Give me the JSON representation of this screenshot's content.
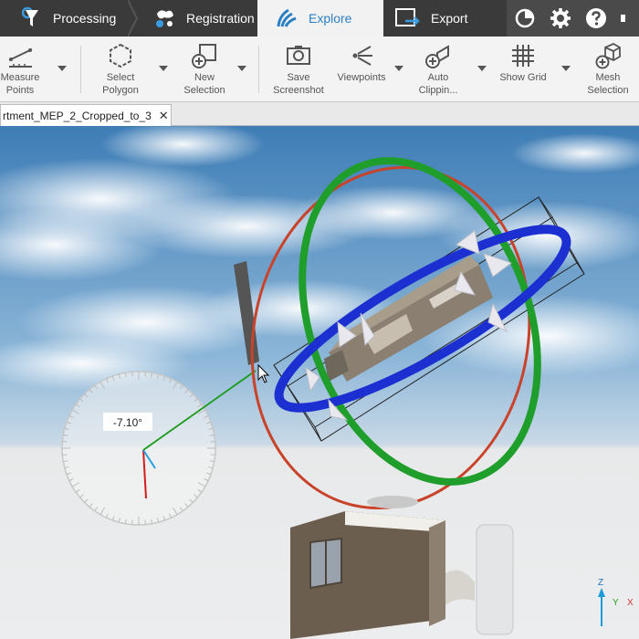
{
  "nav": {
    "tabs": [
      {
        "label": "Processing"
      },
      {
        "label": "Registration"
      },
      {
        "label": "Explore"
      },
      {
        "label": "Export"
      }
    ]
  },
  "toolbar": {
    "measure_points": "Measure\nPoints",
    "select_polygon": "Select\nPolygon",
    "new_selection": "New\nSelection",
    "save_screenshot": "Save\nScreenshot",
    "viewpoints": "Viewpoints",
    "auto_clipping": "Auto\nClippin...",
    "show_grid": "Show Grid",
    "mesh_selection": "Mesh\nSelection"
  },
  "document_tab": {
    "title": "rtment_MEP_2_Cropped_to_3"
  },
  "viewport": {
    "rotation_readout": "-7.10°",
    "axis_z": "Z",
    "axis_y": "Y",
    "axis_x": "X"
  },
  "colors": {
    "accent": "#2a7fc4",
    "ring_x": "#c8432a",
    "ring_y": "#1f9e2c",
    "ring_z": "#1c2fd0"
  }
}
